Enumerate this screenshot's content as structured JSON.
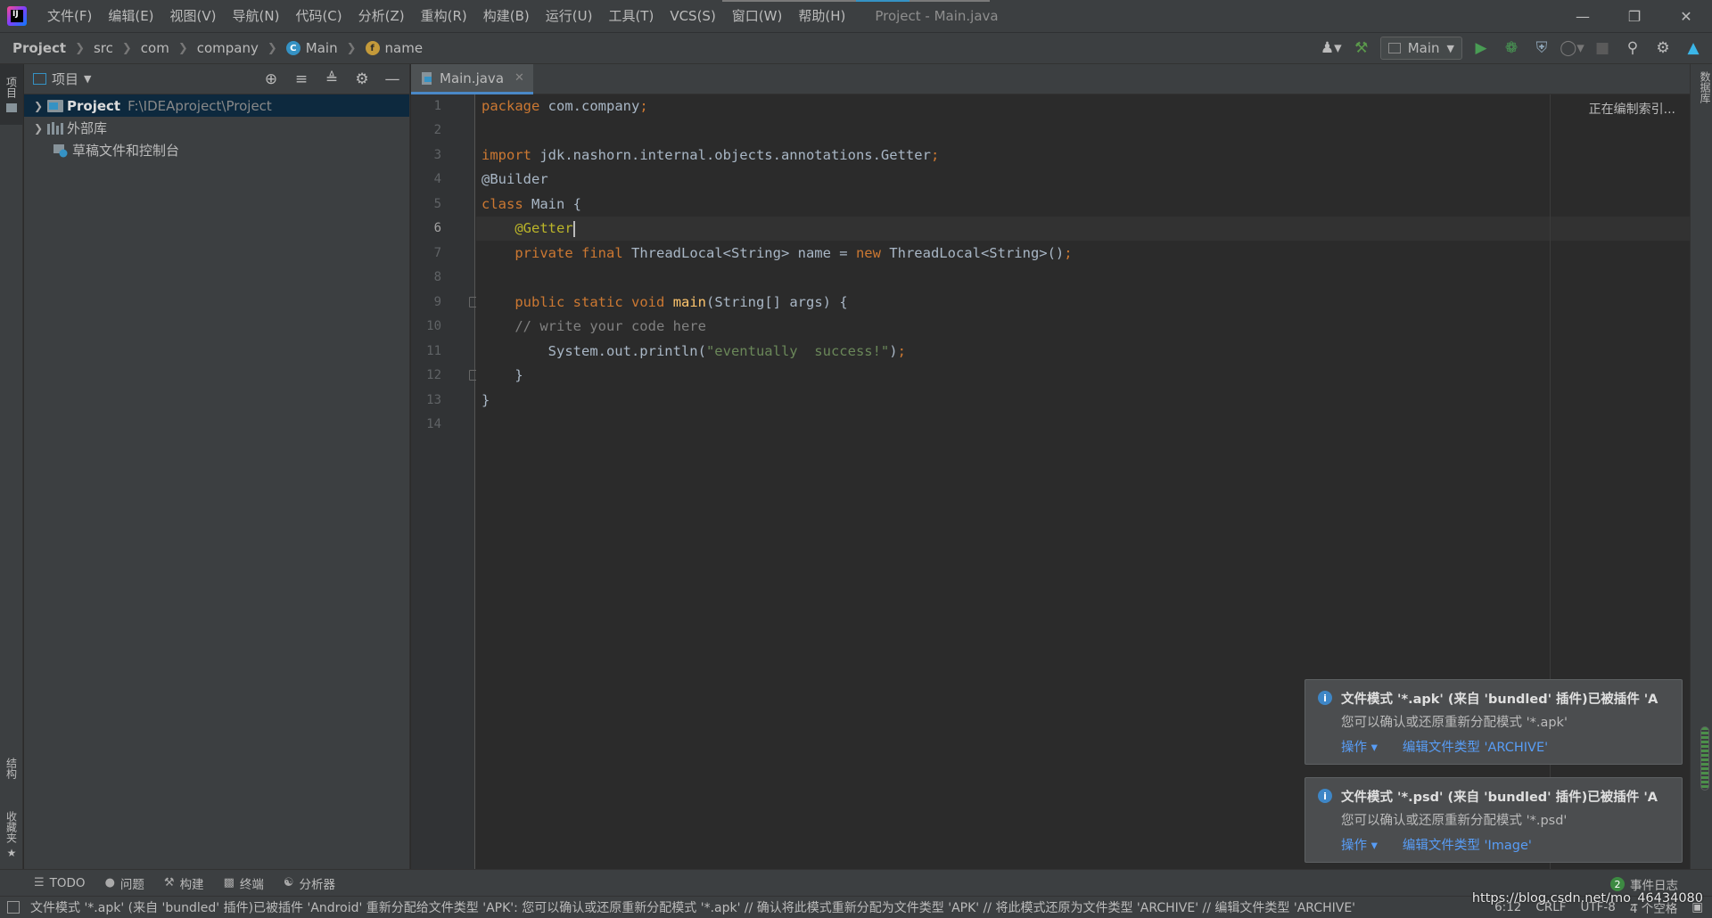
{
  "window": {
    "title": "Project - Main.java",
    "menu": [
      "文件(F)",
      "编辑(E)",
      "视图(V)",
      "导航(N)",
      "代码(C)",
      "分析(Z)",
      "重构(R)",
      "构建(B)",
      "运行(U)",
      "工具(T)",
      "VCS(S)",
      "窗口(W)",
      "帮助(H)"
    ]
  },
  "breadcrumb": [
    "Project",
    "src",
    "com",
    "company",
    "Main",
    "name"
  ],
  "toolbar": {
    "run_config": "Main"
  },
  "left_strip": {
    "project": "项目",
    "structure": "结构",
    "favorites": "收藏夹"
  },
  "right_strip": {
    "database": "数据库"
  },
  "project_panel": {
    "title": "项目",
    "tree": [
      {
        "label": "Project",
        "path": "F:\\IDEAproject\\Project"
      },
      {
        "label": "外部库"
      },
      {
        "label": "草稿文件和控制台"
      }
    ]
  },
  "editor": {
    "tab": "Main.java",
    "status": "正在编制索引...",
    "line_numbers": [
      "1",
      "2",
      "3",
      "4",
      "5",
      "6",
      "7",
      "8",
      "9",
      "10",
      "11",
      "12",
      "13",
      "14"
    ],
    "lines": [
      {
        "kw": "package",
        "rest": " com.company",
        "semi": ";"
      },
      {
        "text": ""
      },
      {
        "kw": "import",
        "rest": " jdk.nashorn.internal.objects.annotations.Getter",
        "semi": ";"
      },
      {
        "ann": "@Builder"
      },
      {
        "kw": "class",
        "rest": " Main {"
      },
      {
        "ann": "    @Getter"
      },
      {
        "text": "    private final ThreadLocal<String> name = new ThreadLocal<String>();"
      },
      {
        "text": ""
      },
      {
        "text": "    public static void main(String[] args) {"
      },
      {
        "text": "    // write your code here"
      },
      {
        "text": "        System.out.println(\"eventually  success!\");"
      },
      {
        "text": "    }"
      },
      {
        "text": "}"
      },
      {
        "text": ""
      }
    ],
    "code": {
      "l7_private": "private",
      "l7_final": "final",
      "l7_a": " ThreadLocal<String> name = ",
      "l7_new": "new",
      "l7_b": " ThreadLocal<String>()",
      "l9_public": "public",
      "l9_static": "static",
      "l9_void": "void",
      "l9_main": "main",
      "l9_rest": "(String[] args) {",
      "l10_comment": "// write your code here",
      "l11_a": "System.out.println(",
      "l11_str": "\"eventually  success!\"",
      "l11_b": ")",
      "l12": "}",
      "l13": "}"
    }
  },
  "notifications": [
    {
      "title": "文件模式 '*.apk' (来自 'bundled' 插件)已被插件 'A",
      "body": "您可以确认或还原重新分配模式 '*.apk'",
      "action1": "操作 ▾",
      "action2": "编辑文件类型 'ARCHIVE'"
    },
    {
      "title": "文件模式 '*.psd' (来自 'bundled' 插件)已被插件 'A",
      "body": "您可以确认或还原重新分配模式 '*.psd'",
      "action1": "操作 ▾",
      "action2": "编辑文件类型 'Image'"
    }
  ],
  "bottom_tools": [
    "TODO",
    "问题",
    "构建",
    "终端",
    "分析器"
  ],
  "event_log": {
    "count": "2",
    "label": "事件日志"
  },
  "status": {
    "message": "文件模式 '*.apk' (来自 'bundled' 插件)已被插件 'Android' 重新分配给文件类型 'APK': 您可以确认或还原重新分配模式 '*.apk' // 确认将此模式重新分配为文件类型 'APK' // 将此模式还原为文件类型 'ARCHIVE' // 编辑文件类型 'ARCHIVE'",
    "position": "6:12",
    "line_sep": "CRLF",
    "encoding": "UTF-8",
    "indent": "4 个空格"
  },
  "watermark": "https://blog.csdn.net/mo_46434080"
}
